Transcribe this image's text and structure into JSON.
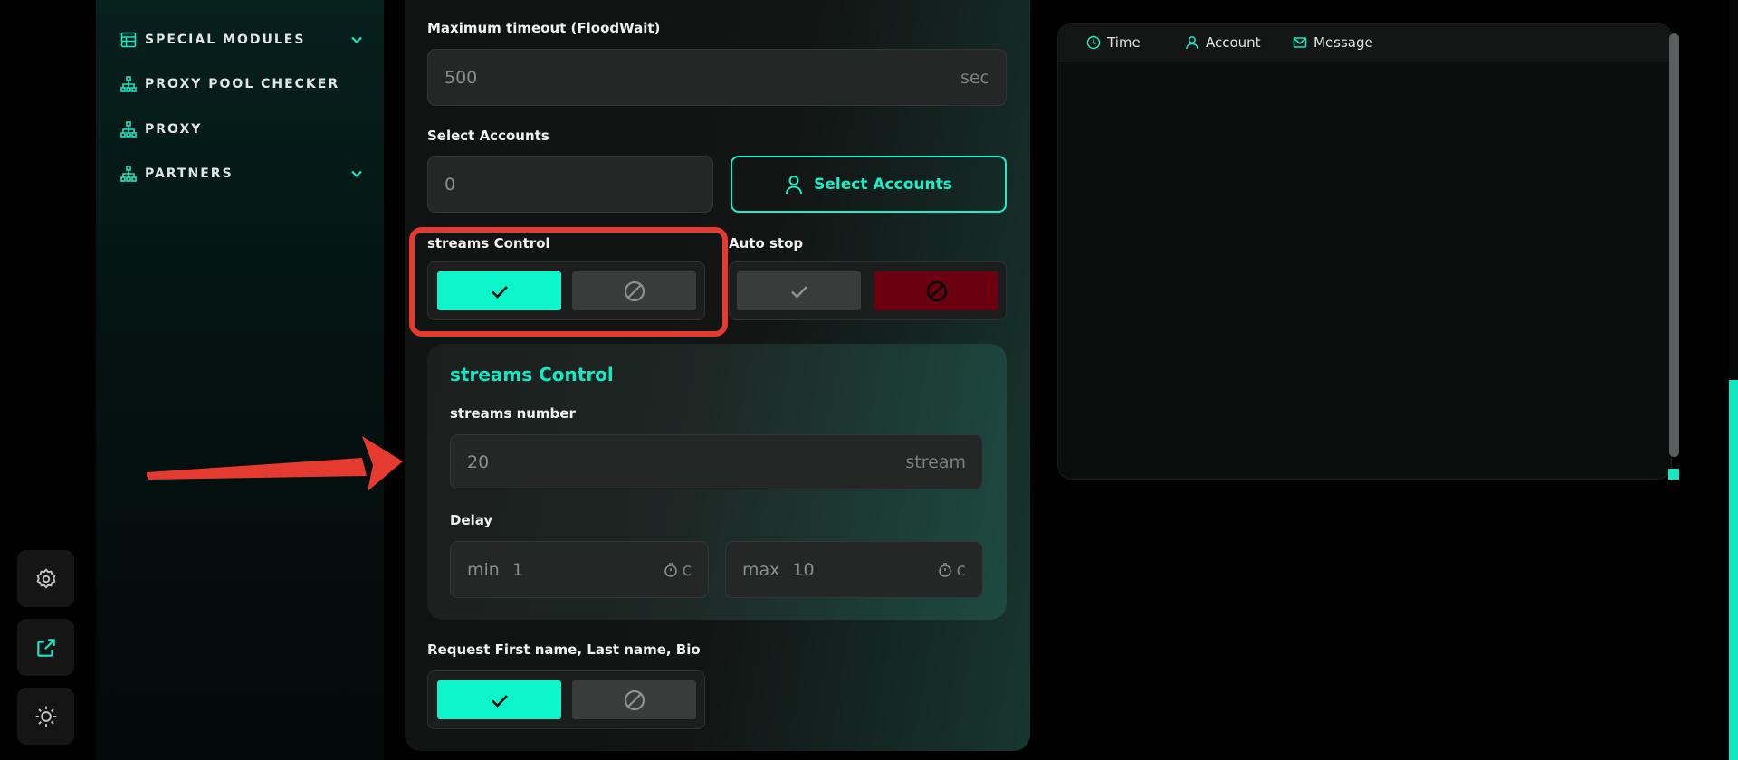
{
  "sidebar": {
    "items": [
      {
        "label": "SPECIAL MODULES",
        "icon": "table-icon",
        "expandable": true
      },
      {
        "label": "PROXY POOL CHECKER",
        "icon": "network-icon",
        "expandable": false
      },
      {
        "label": "PROXY",
        "icon": "network-icon",
        "expandable": false
      },
      {
        "label": "PARTNERS",
        "icon": "network-icon",
        "expandable": true
      }
    ]
  },
  "rail": {
    "items": [
      {
        "icon": "settings-icon"
      },
      {
        "icon": "external-link-icon",
        "active": true
      },
      {
        "icon": "theme-toggle-icon"
      }
    ]
  },
  "form": {
    "timeout": {
      "label": "Maximum timeout (FloodWait)",
      "value": "500",
      "unit": "sec"
    },
    "accounts": {
      "label": "Select Accounts",
      "value": "0",
      "button": "Select Accounts"
    },
    "streams_control": {
      "label": "streams Control",
      "enabled": true
    },
    "auto_stop": {
      "label": "Auto stop",
      "enabled": false
    },
    "streams_card": {
      "title": "streams Control",
      "number_label": "streams number",
      "number_value": "20",
      "number_unit": "stream",
      "delay_label": "Delay",
      "min_prefix": "min",
      "min_value": "1",
      "max_prefix": "max",
      "max_value": "10",
      "delay_unit": "c"
    },
    "request_profile": {
      "label": "Request First name, Last name, Bio",
      "enabled": true
    }
  },
  "log": {
    "columns": [
      {
        "label": "Time",
        "icon": "clock-icon"
      },
      {
        "label": "Account",
        "icon": "user-icon"
      },
      {
        "label": "Message",
        "icon": "mail-icon"
      }
    ]
  },
  "colors": {
    "accent": "#19F0C9",
    "danger": "#6B0011",
    "annotation": "#E53A2F"
  }
}
